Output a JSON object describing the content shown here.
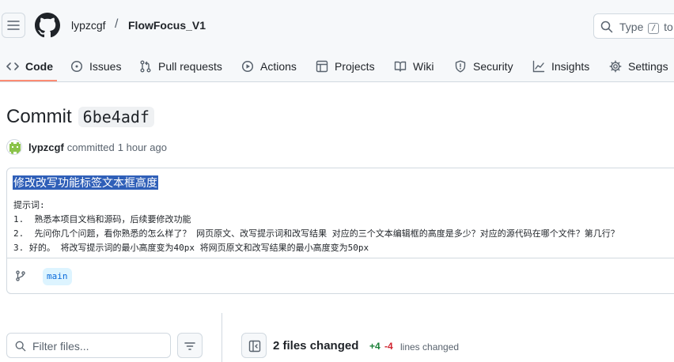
{
  "header": {
    "owner": "lypzcgf",
    "separator": "/",
    "repo": "FlowFocus_V1",
    "search": {
      "type_label": "Type",
      "shortcut_key": "/",
      "to_label": "to"
    }
  },
  "tabs": [
    {
      "label": "Code",
      "icon": "code-icon",
      "active": true
    },
    {
      "label": "Issues",
      "icon": "issue-opened-icon"
    },
    {
      "label": "Pull requests",
      "icon": "git-pull-request-icon"
    },
    {
      "label": "Actions",
      "icon": "play-icon"
    },
    {
      "label": "Projects",
      "icon": "table-icon"
    },
    {
      "label": "Wiki",
      "icon": "book-icon"
    },
    {
      "label": "Security",
      "icon": "shield-icon"
    },
    {
      "label": "Insights",
      "icon": "graph-icon"
    },
    {
      "label": "Settings",
      "icon": "gear-icon"
    }
  ],
  "commit": {
    "heading": "Commit",
    "sha": "6be4adf",
    "author": "lypzcgf",
    "verb": "committed",
    "time": "1 hour ago",
    "title": "修改改写功能标签文本框高度",
    "body_lines": [
      "提示词:",
      "1.  熟悉本项目文档和源码，后续要修改功能",
      "2.  先问你几个问题，看你熟悉的怎么样了？ 网页原文、改写提示词和改写结果 对应的三个文本编辑框的高度是多少？对应的源代码在哪个文件？第几行？",
      "3. 好的。 将改写提示词的最小高度变为40px 将网页原文和改写结果的最小高度变为50px"
    ],
    "branch": "main"
  },
  "files": {
    "filter_placeholder": "Filter files...",
    "summary": "2 files changed",
    "additions": "+4",
    "deletions": "-4",
    "lines_label": "lines changed"
  },
  "colors": {
    "accent_underline": "#fd8c73",
    "selection": "#2f5fb8",
    "additions": "#1a7f37",
    "deletions": "#d1242f",
    "branch_badge_bg": "#ddf4ff",
    "branch_badge_fg": "#0969da"
  }
}
